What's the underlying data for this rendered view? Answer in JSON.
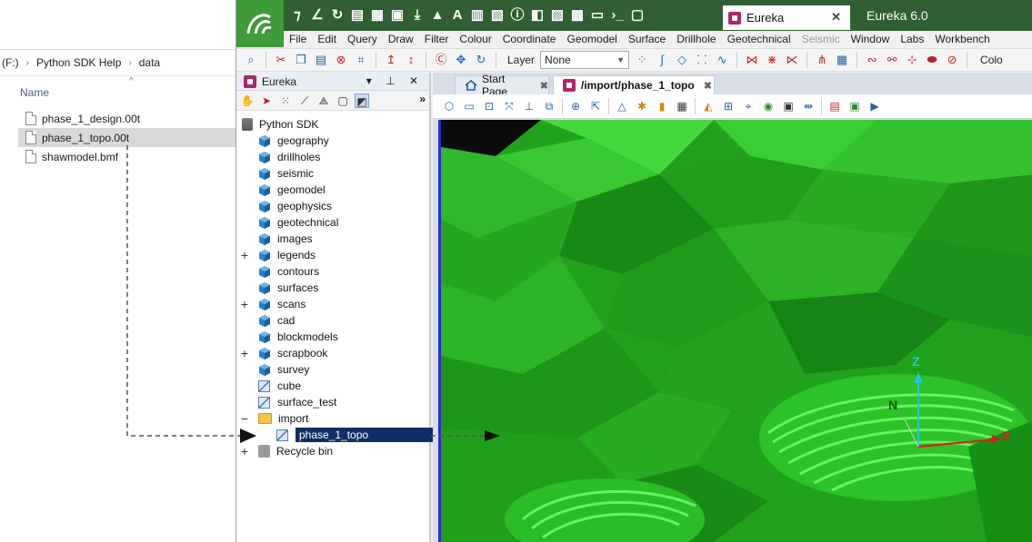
{
  "explorer": {
    "breadcrumb": [
      "(F:)",
      "Python SDK Help",
      "data"
    ],
    "column_name": "Name",
    "files": [
      {
        "name": "phase_1_design.00t",
        "selected": false
      },
      {
        "name": "phase_1_topo.00t",
        "selected": true
      },
      {
        "name": "shawmodel.bmf",
        "selected": false
      }
    ]
  },
  "app": {
    "title": "Eureka 6.0",
    "doc_tab": "Eureka",
    "menu": [
      {
        "label": "File",
        "disabled": false
      },
      {
        "label": "Edit",
        "disabled": false
      },
      {
        "label": "Query",
        "disabled": false
      },
      {
        "label": "Draw",
        "disabled": false
      },
      {
        "label": "Filter",
        "disabled": false
      },
      {
        "label": "Colour",
        "disabled": false
      },
      {
        "label": "Coordinate",
        "disabled": false
      },
      {
        "label": "Geomodel",
        "disabled": false
      },
      {
        "label": "Surface",
        "disabled": false
      },
      {
        "label": "Drillhole",
        "disabled": false
      },
      {
        "label": "Geotechnical",
        "disabled": false
      },
      {
        "label": "Seismic",
        "disabled": true
      },
      {
        "label": "Window",
        "disabled": false
      },
      {
        "label": "Labs",
        "disabled": false
      },
      {
        "label": "Workbench",
        "disabled": false
      }
    ],
    "toolbar": {
      "layer_label": "Layer",
      "layer_value": "None",
      "trail_text": "Colo"
    }
  },
  "tree_panel": {
    "title": "Eureka",
    "root": "Python SDK",
    "items": [
      {
        "label": "geography",
        "icon": "cube",
        "expander": ""
      },
      {
        "label": "drillholes",
        "icon": "cube",
        "expander": ""
      },
      {
        "label": "seismic",
        "icon": "cube",
        "expander": ""
      },
      {
        "label": "geomodel",
        "icon": "cube",
        "expander": ""
      },
      {
        "label": "geophysics",
        "icon": "cube",
        "expander": ""
      },
      {
        "label": "geotechnical",
        "icon": "cube",
        "expander": ""
      },
      {
        "label": "images",
        "icon": "cube",
        "expander": ""
      },
      {
        "label": "legends",
        "icon": "cube",
        "expander": "+"
      },
      {
        "label": "contours",
        "icon": "cube",
        "expander": ""
      },
      {
        "label": "surfaces",
        "icon": "cube",
        "expander": ""
      },
      {
        "label": "scans",
        "icon": "cube",
        "expander": "+"
      },
      {
        "label": "cad",
        "icon": "cube",
        "expander": ""
      },
      {
        "label": "blockmodels",
        "icon": "cube",
        "expander": ""
      },
      {
        "label": "scrapbook",
        "icon": "cube",
        "expander": "+"
      },
      {
        "label": "survey",
        "icon": "cube",
        "expander": ""
      },
      {
        "label": "cube",
        "icon": "surface",
        "expander": ""
      },
      {
        "label": "surface_test",
        "icon": "surface",
        "expander": ""
      },
      {
        "label": "import",
        "icon": "folder",
        "expander": "−"
      },
      {
        "label": "phase_1_topo",
        "icon": "surface",
        "expander": "",
        "selected": true,
        "indent": true
      },
      {
        "label": "Recycle bin",
        "icon": "bin",
        "expander": "+"
      }
    ]
  },
  "viewer": {
    "tabs": [
      {
        "label": "Start Page",
        "active": false
      },
      {
        "label": "/import/phase_1_topo",
        "active": true
      }
    ],
    "axes": {
      "z": "Z",
      "n": "N",
      "e": "E"
    },
    "colors": {
      "terrain": "#1ea01e",
      "axis_z": "#27c6d8",
      "axis_e": "#d81e1e"
    }
  }
}
